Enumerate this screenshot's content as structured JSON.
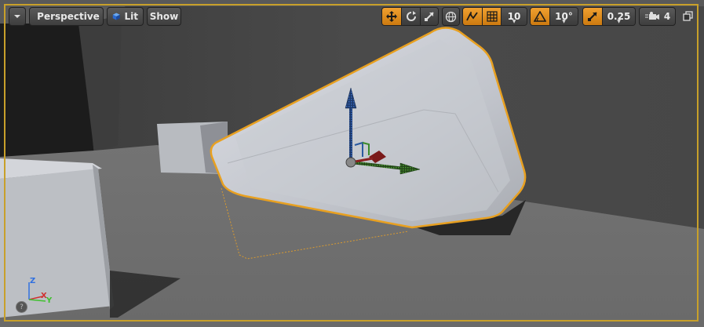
{
  "toolbar": {
    "menu_icon": "chevron-down-icon",
    "perspective_label": "Perspective",
    "lit_label": "Lit",
    "show_label": "Show",
    "grid_snap_value": "10",
    "rotation_snap_value": "10°",
    "scale_snap_value": "0.25",
    "camera_speed_value": "4"
  },
  "axes": {
    "z": "Z",
    "x": "X",
    "y": "Y"
  },
  "help_glyph": "?",
  "colors": {
    "accent": "#e8a33a",
    "selection": "#e8a020",
    "axis_x": "#d03030",
    "axis_y": "#40c030",
    "axis_z": "#3070e0"
  }
}
